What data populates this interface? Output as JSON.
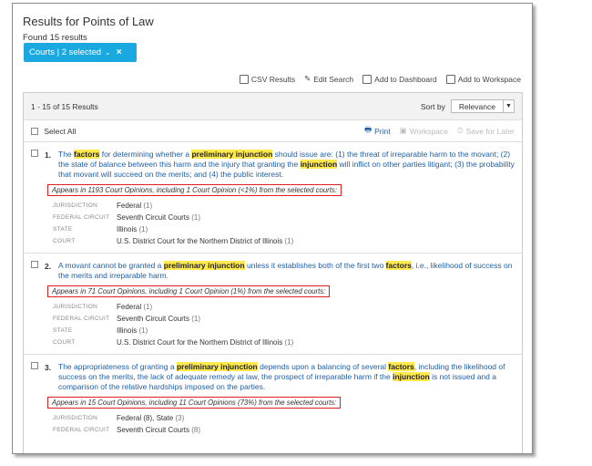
{
  "header": {
    "title": "Results for Points of Law",
    "found": "Found 15 results",
    "filter_chip": "Courts | 2 selected"
  },
  "actions": [
    {
      "label": "CSV Results",
      "icon": "csv-icon"
    },
    {
      "label": "Edit Search",
      "icon": "pencil-icon"
    },
    {
      "label": "Add to Dashboard",
      "icon": "dashboard-icon"
    },
    {
      "label": "Add to Workspace",
      "icon": "workspace-icon"
    }
  ],
  "panel": {
    "count_text": "1 - 15 of 15 Results",
    "sort_label": "Sort by",
    "sort_value": "Relevance",
    "select_all": "Select All",
    "tools": [
      "Print",
      "Workspace",
      "Save for Later"
    ]
  },
  "results": [
    {
      "num": "1.",
      "appears": "Appears in 1193 Court Opinions, including 1 Court Opinion (<1%) from the selected courts:",
      "facets": [
        {
          "label": "JURISDICTION",
          "value": "Federal",
          "count": "(1)"
        },
        {
          "label": "FEDERAL CIRCUIT",
          "value": "Seventh Circuit Courts",
          "count": "(1)"
        },
        {
          "label": "STATE",
          "value": "Illinois",
          "count": "(1)"
        },
        {
          "label": "COURT",
          "value": "U.S. District Court for the Northern District of Illinois",
          "count": "(1)"
        }
      ]
    },
    {
      "num": "2.",
      "appears": "Appears in 71 Court Opinions, including 1 Court Opinion (1%) from the selected courts:",
      "facets": [
        {
          "label": "JURISDICTION",
          "value": "Federal",
          "count": "(1)"
        },
        {
          "label": "FEDERAL CIRCUIT",
          "value": "Seventh Circuit Courts",
          "count": "(1)"
        },
        {
          "label": "STATE",
          "value": "Illinois",
          "count": "(1)"
        },
        {
          "label": "COURT",
          "value": "U.S. District Court for the Northern District of Illinois",
          "count": "(1)"
        }
      ]
    },
    {
      "num": "3.",
      "appears": "Appears in 15 Court Opinions, including 11 Court Opinions (73%) from the selected courts:",
      "facets": [
        {
          "label": "JURISDICTION",
          "value": "Federal (8), State",
          "count": "(3)"
        },
        {
          "label": "FEDERAL CIRCUIT",
          "value": "Seventh Circuit Courts",
          "count": "(8)"
        }
      ]
    }
  ],
  "result_text": {
    "r1": [
      "The ",
      "factors",
      " for determining whether a ",
      "preliminary injunction",
      " should issue are: (1) the threat of irreparable harm to the movant; (2) the state of balance between this harm and the injury that granting the ",
      "injunction",
      " will inflict on other parties litigant; (3) the probability that movant will succeed on the merits; and (4) the public interest."
    ],
    "r2": [
      "A movant cannot be granted a ",
      "preliminary injunction",
      " unless it establishes both of the first two ",
      "factors",
      ", i.e., likelihood of success on the merits and irreparable harm."
    ],
    "r3": [
      "The appropriateness of granting a ",
      "preliminary injunction",
      " depends upon a balancing of several ",
      "factors",
      ", including the likelihood of success on the merits, the lack of adequate remedy at law, the prospect of irreparable harm if the ",
      "injunction",
      " is not issued and a comparison of the relative hardships imposed on the parties."
    ]
  },
  "colors": {
    "accent": "#1aa8e0",
    "link": "#1f5fa8",
    "highlight": "#ffe94d",
    "box": "#e02020"
  }
}
